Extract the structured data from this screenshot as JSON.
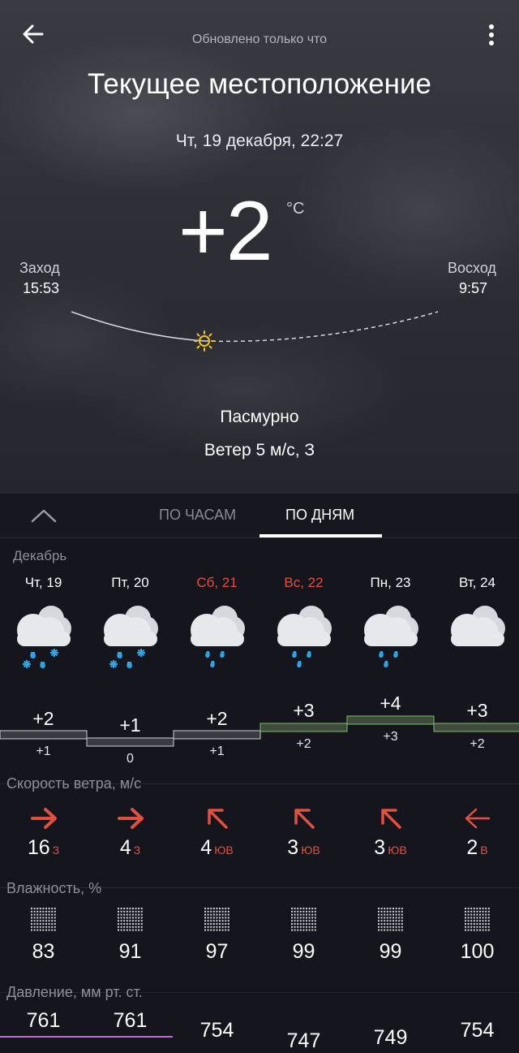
{
  "header": {
    "updated": "Обновлено только что",
    "location": "Текущее местоположение",
    "datetime": "Чт, 19 декабря, 22:27"
  },
  "current": {
    "temperature": "+2",
    "unit": "°C",
    "condition": "Пасмурно",
    "wind": "Ветер 5 м/с, З"
  },
  "sun": {
    "sunset_label": "Заход",
    "sunset_time": "15:53",
    "sunrise_label": "Восход",
    "sunrise_time": "9:57"
  },
  "tabs": {
    "hours": "ПО ЧАСАМ",
    "days": "ПО ДНЯМ",
    "active": "days"
  },
  "month": "Декабрь",
  "days": [
    {
      "name": "Чт, 19",
      "weekend": false,
      "precip": "snow-rain-icon",
      "hi": "+2",
      "lo": "+1",
      "wind_speed": "16",
      "wind_dir": "З",
      "wind_icon": "arrow-east-icon",
      "humidity": "83",
      "pressure": "761"
    },
    {
      "name": "Пт, 20",
      "weekend": false,
      "precip": "snow-rain-icon",
      "hi": "+1",
      "lo": "0",
      "wind_speed": "4",
      "wind_dir": "З",
      "wind_icon": "arrow-east-icon",
      "humidity": "91",
      "pressure": "761"
    },
    {
      "name": "Сб, 21",
      "weekend": true,
      "precip": "rain-icon",
      "hi": "+2",
      "lo": "+1",
      "wind_speed": "4",
      "wind_dir": "ЮВ",
      "wind_icon": "arrow-northwest-icon",
      "humidity": "97",
      "pressure": "754"
    },
    {
      "name": "Вс, 22",
      "weekend": true,
      "precip": "rain-icon",
      "hi": "+3",
      "lo": "+2",
      "wind_speed": "3",
      "wind_dir": "ЮВ",
      "wind_icon": "arrow-northwest-icon",
      "humidity": "99",
      "pressure": "747"
    },
    {
      "name": "Пн, 23",
      "weekend": false,
      "precip": "rain-icon",
      "hi": "+4",
      "lo": "+3",
      "wind_speed": "3",
      "wind_dir": "ЮВ",
      "wind_icon": "arrow-northwest-icon",
      "humidity": "99",
      "pressure": "749"
    },
    {
      "name": "Вт, 24",
      "weekend": false,
      "precip": "cloud-icon",
      "hi": "+3",
      "lo": "+2",
      "wind_speed": "2",
      "wind_dir": "В",
      "wind_icon": "arrow-west-icon",
      "humidity": "100",
      "pressure": "754"
    }
  ],
  "sections": {
    "wind": "Скорость ветра, м/с",
    "humidity": "Влажность, %",
    "pressure": "Давление, мм рт. ст."
  },
  "colors": {
    "weekend": "#e2503f",
    "wind_arrow": "#e2503f",
    "precip": "#2aa7e8",
    "sun": "#f0c419",
    "warm_bar": "#7fbf6a",
    "pressure_bar": "#c36ad6"
  }
}
